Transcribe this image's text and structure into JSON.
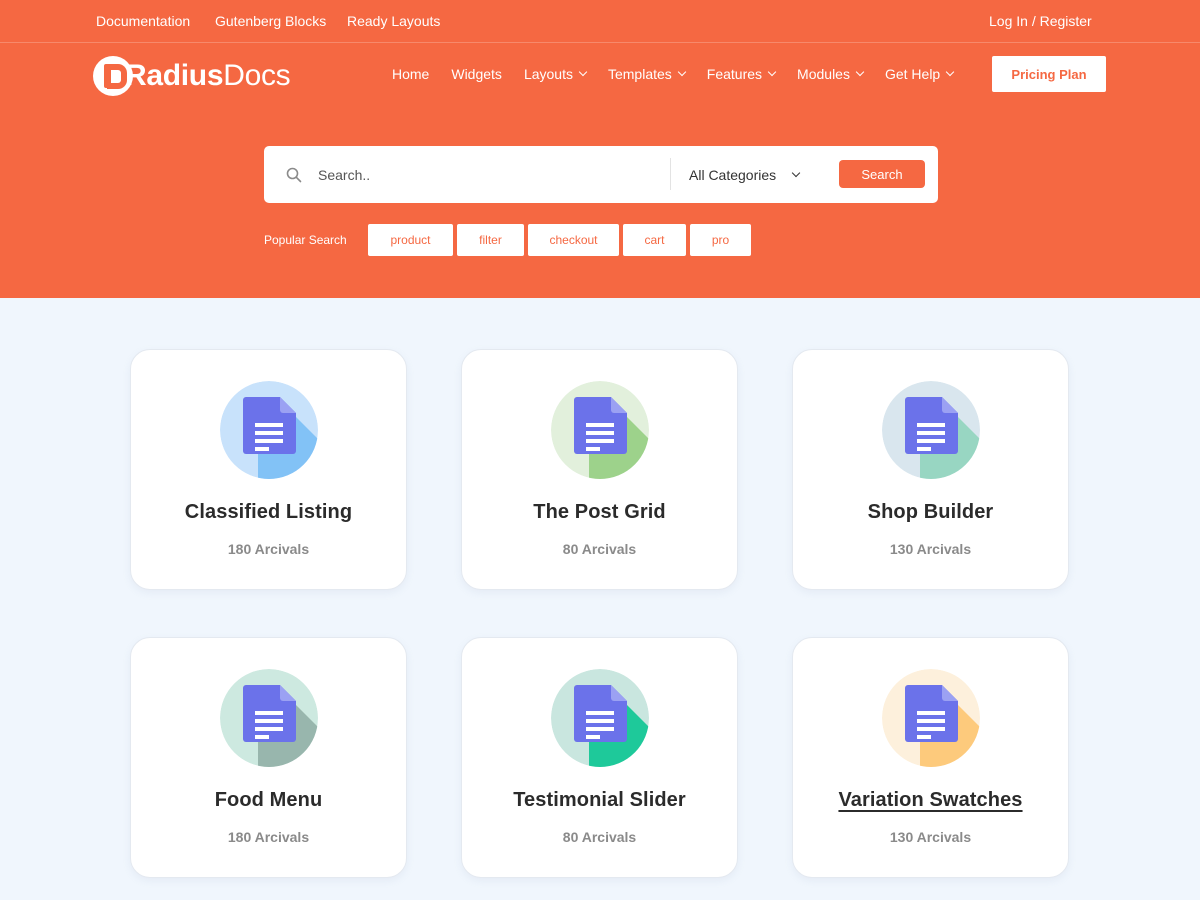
{
  "topbar": {
    "links": [
      "Documentation",
      "Gutenberg Blocks",
      "Ready Layouts"
    ],
    "login": "Log In / Register"
  },
  "logo": {
    "text_bold": "Radius",
    "text_light": "Docs"
  },
  "nav": {
    "items": [
      {
        "label": "Home",
        "has_dropdown": false
      },
      {
        "label": "Widgets",
        "has_dropdown": false
      },
      {
        "label": "Layouts",
        "has_dropdown": true
      },
      {
        "label": "Templates",
        "has_dropdown": true
      },
      {
        "label": "Features",
        "has_dropdown": true
      },
      {
        "label": "Modules",
        "has_dropdown": true
      },
      {
        "label": "Get Help",
        "has_dropdown": true
      }
    ],
    "pricing_label": "Pricing Plan"
  },
  "search": {
    "placeholder": "Search..",
    "category_selected": "All Categories",
    "button_label": "Search",
    "popular_label": "Popular Search",
    "popular_tags": [
      "product",
      "filter",
      "checkout",
      "cart",
      "pro"
    ]
  },
  "colors": {
    "brand": "#f56842",
    "page_background": "#f0f6fd",
    "doc_icon": "#6b72ea"
  },
  "cards": [
    {
      "title": "Classified Listing",
      "count": "180 Arcivals",
      "icon": "document-icon",
      "circle_color": "#c8e2fb",
      "shadow_color": "#82c2f6",
      "underlined": false
    },
    {
      "title": "The Post Grid",
      "count": "80 Arcivals",
      "icon": "document-icon",
      "circle_color": "#e2f0dc",
      "shadow_color": "#9dd28b",
      "underlined": false
    },
    {
      "title": "Shop Builder",
      "count": "130 Arcivals",
      "icon": "document-icon",
      "circle_color": "#d9e6ee",
      "shadow_color": "#98d6c2",
      "underlined": false
    },
    {
      "title": "Food Menu",
      "count": "180 Arcivals",
      "icon": "document-icon",
      "circle_color": "#cde9e0",
      "shadow_color": "#98b6ad",
      "underlined": false
    },
    {
      "title": "Testimonial Slider",
      "count": "80 Arcivals",
      "icon": "document-icon",
      "circle_color": "#c9e6df",
      "shadow_color": "#1ec99a",
      "underlined": false
    },
    {
      "title": "Variation Swatches",
      "count": "130 Arcivals",
      "icon": "document-icon",
      "circle_color": "#fdf0dc",
      "shadow_color": "#fdca7c",
      "underlined": true
    }
  ]
}
